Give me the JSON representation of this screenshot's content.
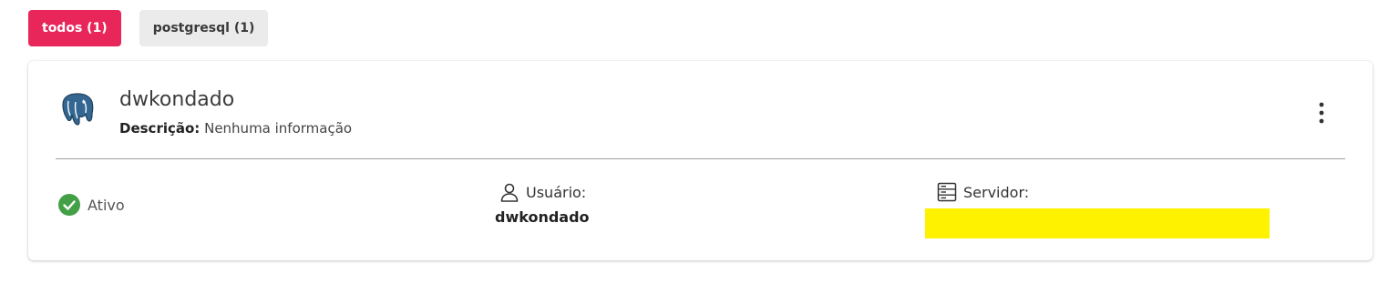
{
  "filters": [
    {
      "label": "todos (1)",
      "active": true
    },
    {
      "label": "postgresql (1)",
      "active": false
    }
  ],
  "connection": {
    "name": "dwkondado",
    "description_label": "Descrição:",
    "description_value": "Nenhuma informação",
    "icon": "postgresql-elephant-icon",
    "status": "Ativo",
    "status_color": "#43a047",
    "user_label": "Usuário:",
    "user_value": "dwkondado",
    "server_label": "Servidor:",
    "server_value_redacted": true
  },
  "colors": {
    "accent": "#e8265a",
    "redaction": "#fff200"
  }
}
